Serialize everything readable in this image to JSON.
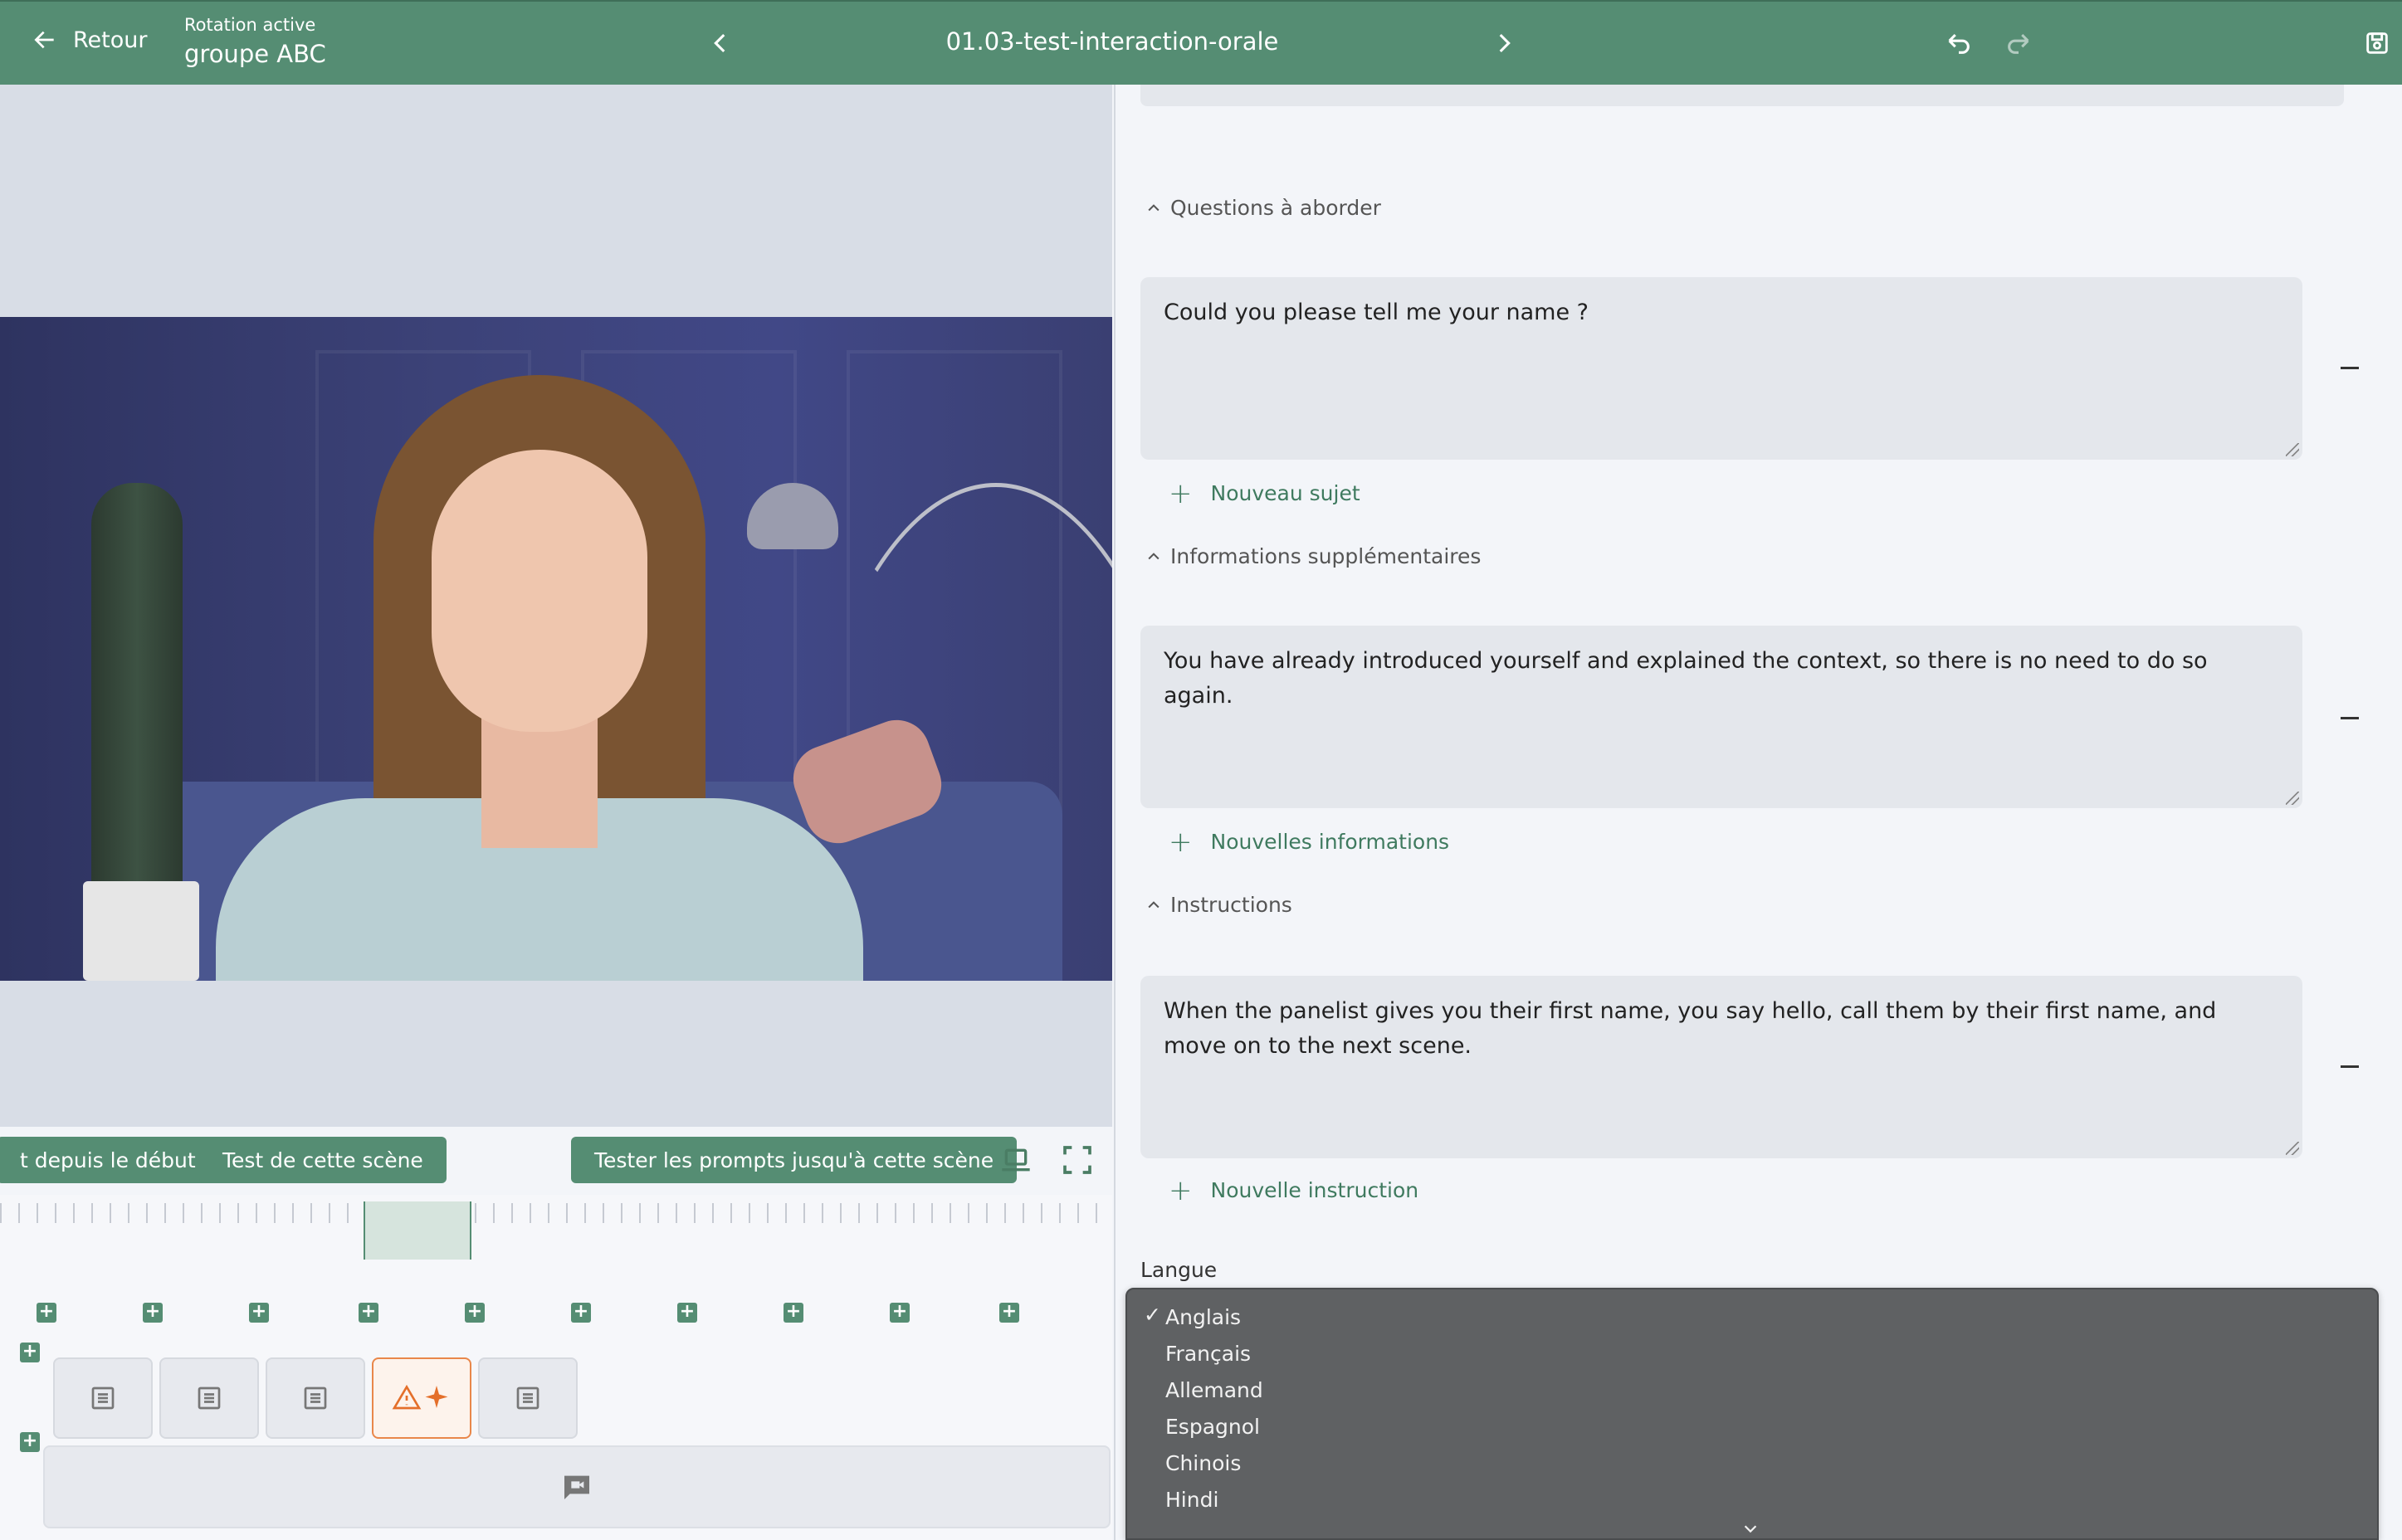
{
  "header": {
    "back_label": "Retour",
    "rotation_label": "Rotation active",
    "rotation_value": "groupe ABC",
    "title": "01.03-test-interaction-orale"
  },
  "toolbar": {
    "test_from_start": "t depuis le début",
    "test_scene": "Test de cette scène",
    "test_prompts": "Tester les prompts jusqu'à cette scène"
  },
  "sections": {
    "questions": {
      "heading": "Questions à aborder",
      "text": "Could you please tell me your name ?",
      "add_label": "Nouveau sujet"
    },
    "info": {
      "heading": "Informations supplémentaires",
      "text": "You have already introduced yourself and explained the context, so there is no need to do so again.",
      "add_label": "Nouvelles informations"
    },
    "instructions": {
      "heading": "Instructions",
      "text": "When the panelist gives you their first name, you say hello, call them by their first name, and move on to the next scene.",
      "add_label": "Nouvelle instruction"
    }
  },
  "language": {
    "label": "Langue",
    "selected": "Anglais",
    "check_mark": "✓",
    "options": [
      "Anglais",
      "Français",
      "Allemand",
      "Espagnol",
      "Chinois",
      "Hindi"
    ]
  },
  "colors": {
    "brand": "#558d73",
    "accent_warning": "#e46f2a"
  }
}
